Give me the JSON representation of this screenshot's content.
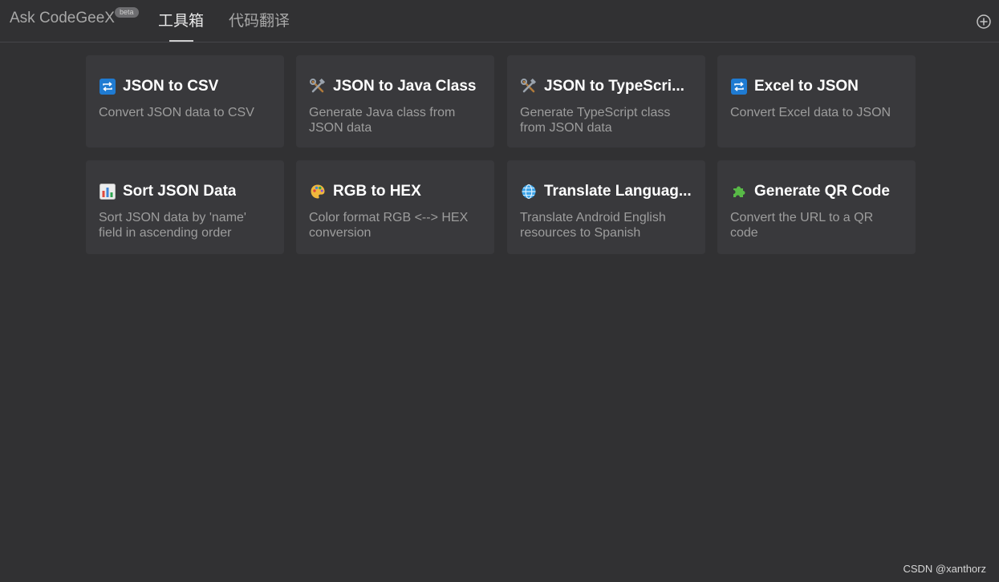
{
  "header": {
    "brand": "Ask CodeGeeX",
    "beta_badge": "beta",
    "tabs": [
      {
        "label": "工具箱",
        "active": true
      },
      {
        "label": "代码翻译",
        "active": false
      }
    ],
    "add_icon": "plus-circle-icon"
  },
  "tools": [
    {
      "title": "JSON to CSV",
      "description": "Convert JSON data to CSV",
      "icon": "repeat-icon"
    },
    {
      "title": "JSON to Java Class",
      "description": "Generate Java class from JSON data",
      "icon": "hammer-wrench-icon"
    },
    {
      "title": "JSON to TypeScri...",
      "description": "Generate TypeScript class from JSON data",
      "icon": "hammer-wrench-icon"
    },
    {
      "title": "Excel to JSON",
      "description": "Convert Excel data to JSON",
      "icon": "repeat-icon"
    },
    {
      "title": "Sort JSON Data",
      "description": "Sort JSON data by 'name' field in ascending order",
      "icon": "bar-chart-icon"
    },
    {
      "title": "RGB to HEX",
      "description": "Color format RGB <--> HEX conversion",
      "icon": "palette-icon"
    },
    {
      "title": "Translate Languag...",
      "description": "Translate Android English resources to Spanish",
      "icon": "globe-icon"
    },
    {
      "title": "Generate QR Code",
      "description": "Convert the URL to a QR code",
      "icon": "puzzle-icon"
    }
  ],
  "watermark": "CSDN @xanthorz",
  "colors": {
    "background": "#313133",
    "card": "#39393c",
    "title": "#ffffff",
    "description": "#9d9d9d"
  }
}
